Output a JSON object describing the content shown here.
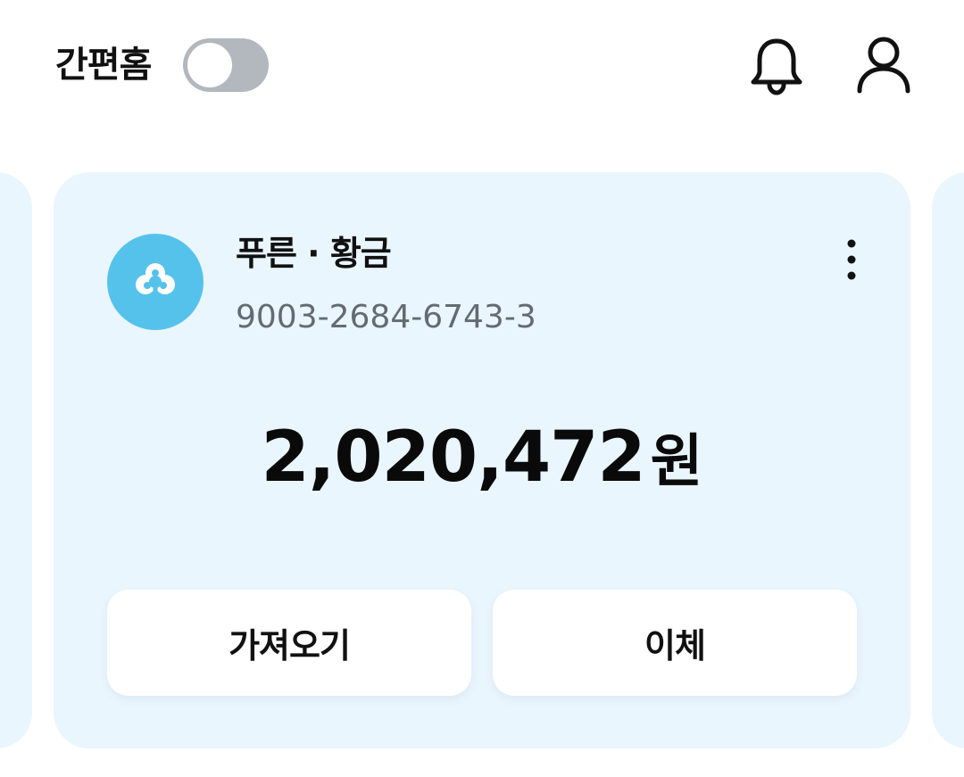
{
  "header": {
    "simple_home_label": "간편홈",
    "simple_home_toggle_on": false,
    "icons": [
      "bell-icon",
      "profile-icon"
    ]
  },
  "account": {
    "name": "푸른 · 황금",
    "number": "9003-2684-6743-3",
    "balance": "2,020,472",
    "currency_unit": "원",
    "logo_icon": "clover-icon",
    "more_icon": "more-vertical-icon",
    "actions": {
      "import_label": "가져오기",
      "transfer_label": "이체"
    }
  },
  "colors": {
    "card_background": "#eaf6fe",
    "logo_background": "#55c2ec",
    "toggle_off": "#b3b8bf",
    "account_number_text": "#636a73"
  }
}
